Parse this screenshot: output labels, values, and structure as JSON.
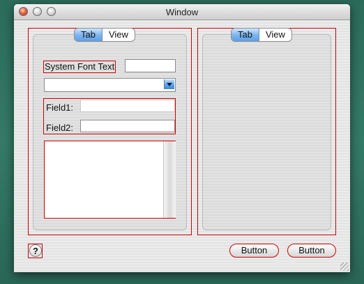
{
  "window": {
    "title": "Window"
  },
  "left_panel": {
    "tabs": [
      {
        "label": "Tab",
        "selected": true
      },
      {
        "label": "View",
        "selected": false
      }
    ],
    "static_label": "System Font Text",
    "text_field_value": "",
    "popup_value": "",
    "field1_label": "Field1:",
    "field1_value": "",
    "field2_label": "Field2:",
    "field2_value": "",
    "text_area_value": ""
  },
  "right_panel": {
    "tabs": [
      {
        "label": "Tab",
        "selected": true
      },
      {
        "label": "View",
        "selected": false
      }
    ]
  },
  "footer": {
    "help_label": "?",
    "button1_label": "Button",
    "button2_label": "Button"
  },
  "colors": {
    "outline": "#cc0000",
    "selection": "#5d9fe6",
    "desktop": "#2f6f5e"
  }
}
